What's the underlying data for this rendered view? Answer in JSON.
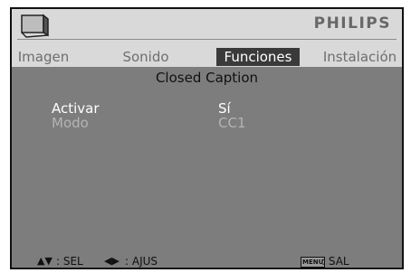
{
  "header": {
    "brand": "PHILIPS",
    "tv_icon": "tv-icon"
  },
  "tabs": [
    {
      "label": "Imagen",
      "active": false
    },
    {
      "label": "Sonido",
      "active": false
    },
    {
      "label": "Funciones",
      "active": true
    },
    {
      "label": "Instalación",
      "active": false
    }
  ],
  "section": {
    "title": "Closed Caption"
  },
  "settings": [
    {
      "label": "Activar",
      "value": "Sí",
      "state": "selected"
    },
    {
      "label": "Modo",
      "value": "CC1",
      "state": "dimmed"
    }
  ],
  "footer": {
    "sel_icon": "▲▼",
    "sel_label": ": SEL",
    "ajus_icon": "◀▶",
    "ajus_label": ": AJUS",
    "menu_icon": "MENU",
    "sal_label": ": SAL"
  },
  "colors": {
    "header_bg": "#d9d9d9",
    "body_bg": "#7d7d7d",
    "active_tab_bg": "#3a3a3a",
    "active_text": "#ffffff",
    "dimmed_text": "#b4b4b4"
  }
}
